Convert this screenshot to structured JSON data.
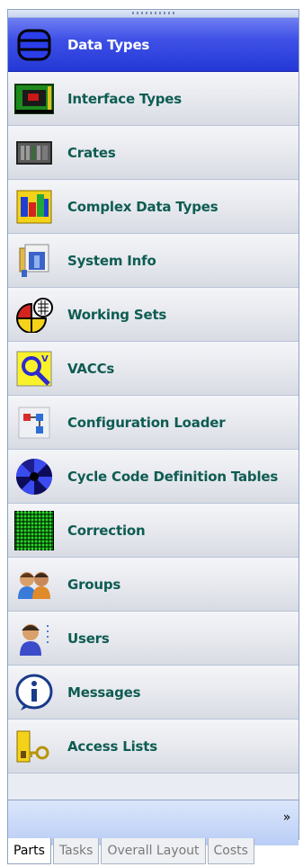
{
  "navigator": {
    "items": [
      {
        "label": "Data Types",
        "icon": "database-icon",
        "selected": true
      },
      {
        "label": "Interface Types",
        "icon": "circuit-board-icon",
        "selected": false
      },
      {
        "label": "Crates",
        "icon": "crate-icon",
        "selected": false
      },
      {
        "label": "Complex Data Types",
        "icon": "complex-data-icon",
        "selected": false
      },
      {
        "label": "System Info",
        "icon": "system-info-icon",
        "selected": false
      },
      {
        "label": "Working Sets",
        "icon": "working-sets-icon",
        "selected": false
      },
      {
        "label": "VACCs",
        "icon": "vaccs-icon",
        "selected": false
      },
      {
        "label": "Configuration Loader",
        "icon": "configuration-loader-icon",
        "selected": false
      },
      {
        "label": "Cycle Code Definition Tables",
        "icon": "cycle-code-icon",
        "selected": false
      },
      {
        "label": "Correction",
        "icon": "correction-grid-icon",
        "selected": false
      },
      {
        "label": "Groups",
        "icon": "groups-icon",
        "selected": false
      },
      {
        "label": "Users",
        "icon": "user-icon",
        "selected": false
      },
      {
        "label": "Messages",
        "icon": "info-icon",
        "selected": false
      },
      {
        "label": "Access Lists",
        "icon": "key-lock-icon",
        "selected": false
      }
    ],
    "overflow_icon": "»"
  },
  "tabs": [
    {
      "label": "Parts",
      "active": true
    },
    {
      "label": "Tasks",
      "active": false
    },
    {
      "label": "Overall Layout",
      "active": false
    },
    {
      "label": "Costs",
      "active": false
    }
  ],
  "colors": {
    "selected_bg": "#2f44dd",
    "label_text": "#0e5c52",
    "selected_text": "#ffffff"
  }
}
